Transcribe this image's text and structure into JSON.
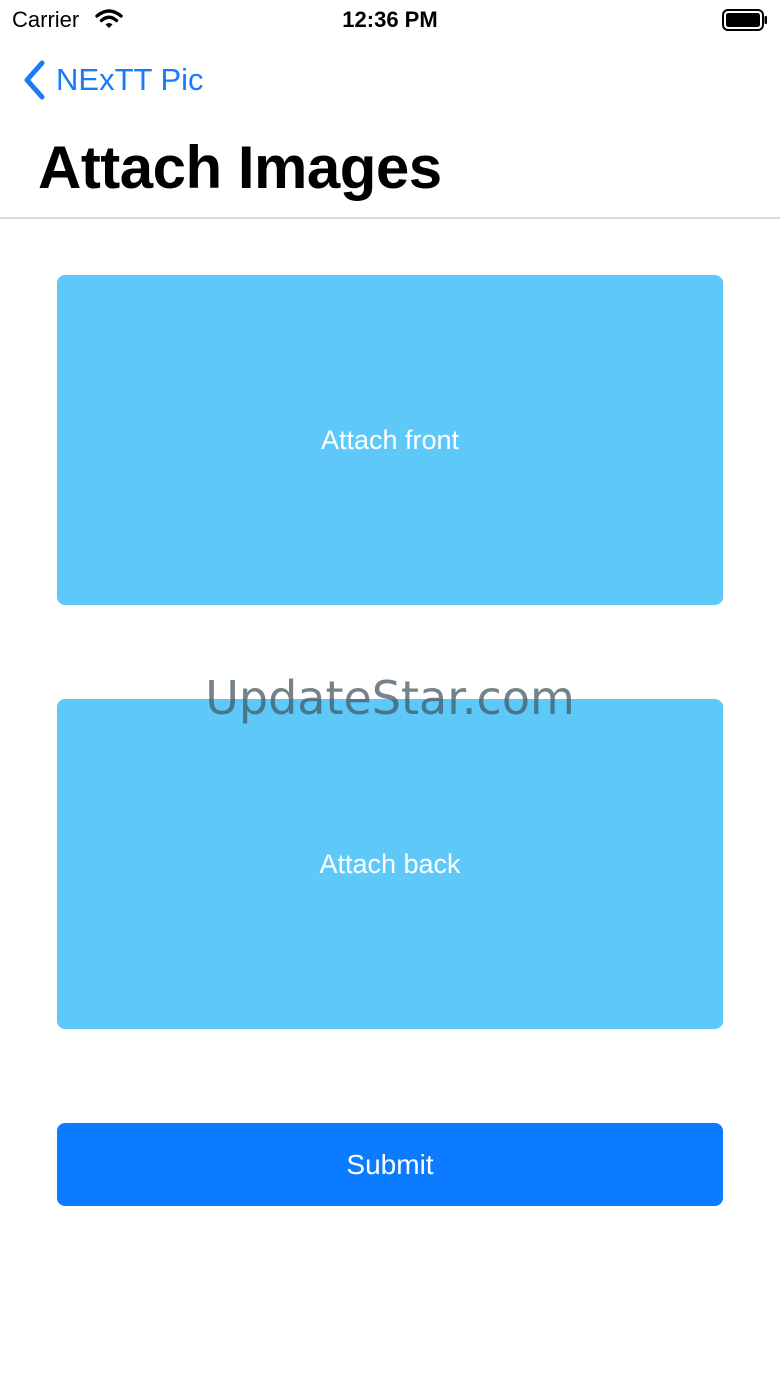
{
  "status_bar": {
    "carrier": "Carrier",
    "time": "12:36 PM",
    "icons": [
      "wifi-icon",
      "battery-icon"
    ]
  },
  "nav": {
    "back_label": "NExTT Pic",
    "back_icon": "chevron-left-icon",
    "title": "Attach Images"
  },
  "attachments": {
    "front_label": "Attach front",
    "back_label": "Attach back"
  },
  "actions": {
    "submit_label": "Submit"
  },
  "watermark": "UpdateStar.com",
  "colors": {
    "tint": "#1a7cf5",
    "attach_box": "#5ec8f9",
    "submit": "#0b7bff"
  }
}
